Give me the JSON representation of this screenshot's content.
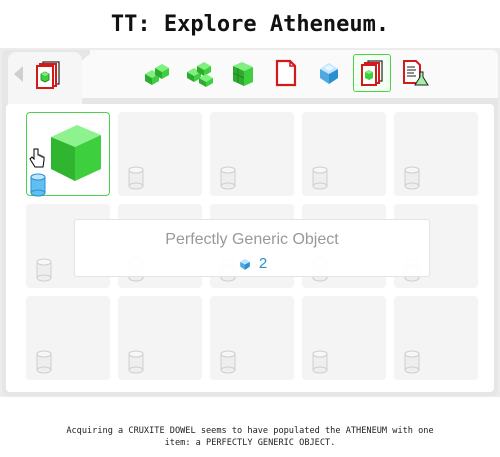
{
  "header": {
    "title": "TT: Explore Atheneum."
  },
  "tabs": {
    "back_icon": "back-arrow-icon",
    "current_icon": "atheneum-document-icon"
  },
  "toolbar": {
    "tools": [
      {
        "icon": "green-cluster-icon",
        "active": false
      },
      {
        "icon": "green-stairs-icon",
        "active": false
      },
      {
        "icon": "green-block-icon",
        "active": false
      },
      {
        "icon": "red-document-icon",
        "active": false
      },
      {
        "icon": "blue-crystal-icon",
        "active": false
      },
      {
        "icon": "atheneum-document-icon",
        "active": true
      },
      {
        "icon": "document-flask-icon",
        "active": false
      }
    ]
  },
  "grid": {
    "rows": 3,
    "columns": 5,
    "selected_slot": {
      "item": "perfectly-generic-object",
      "icon": "green-cube-icon",
      "badge": "blue-cylinder-icon"
    }
  },
  "tooltip": {
    "name": "Perfectly Generic Object",
    "quantity": "2",
    "quantity_icon": "blue-crystal-icon"
  },
  "message": {
    "line1": "Acquiring a CRUXITE DOWEL seems to have populated the ATHENEUM with one",
    "line2": "item: a PERFECTLY GENERIC OBJECT."
  },
  "colors": {
    "accent_green": "#4cd14c",
    "cube_green": "#3ecf3e",
    "quantity_blue": "#2a8fd0",
    "doc_red": "#d11a1a"
  }
}
